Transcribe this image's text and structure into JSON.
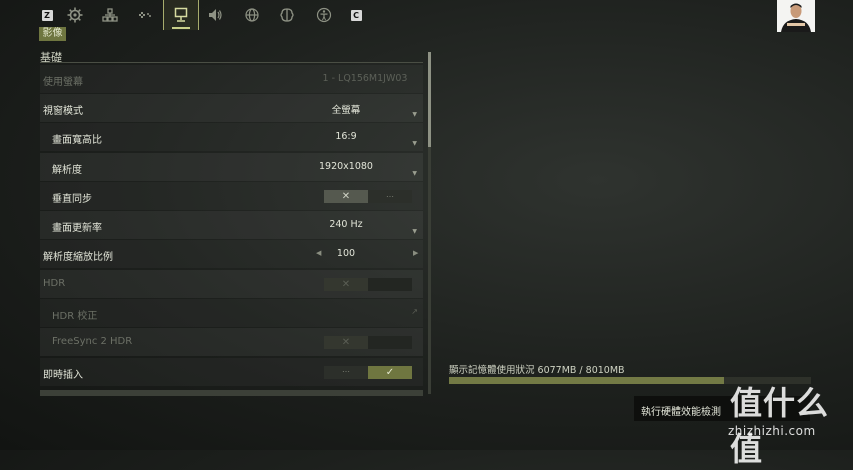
{
  "tabs": {
    "key_left": "Z",
    "key_right": "C",
    "items": [
      "gear-icon",
      "network-icon",
      "gamepad-icon",
      "display-icon",
      "audio-icon",
      "globe-icon",
      "brain-icon",
      "accessibility-icon"
    ],
    "active": "display-icon"
  },
  "category_label": "影像",
  "section_title": "基礎",
  "settings": [
    {
      "label": "使用螢幕",
      "value": "1 - LQ156M1JW03",
      "state": "dim"
    },
    {
      "label": "視窗模式",
      "value": "全螢幕"
    },
    {
      "label": "畫面寬高比",
      "value": "16:9"
    },
    {
      "label": "解析度",
      "value": "1920x1080"
    },
    {
      "label": "垂直同步",
      "toggle": "off"
    },
    {
      "label": "畫面更新率",
      "value": "240 Hz"
    },
    {
      "label": "解析度縮放比例",
      "value": "100"
    },
    {
      "label": "HDR",
      "toggle": "off",
      "state": "dim"
    },
    {
      "label": "HDR 校正",
      "state": "dim"
    },
    {
      "label": "FreeSync 2 HDR",
      "toggle": "off",
      "state": "dim"
    },
    {
      "label": "即時插入",
      "toggle": "on"
    }
  ],
  "vram": {
    "label": "顯示記憶體使用狀況 6077MB / 8010MB",
    "used_mb": 6077,
    "total_mb": 8010
  },
  "benchmark_button": "執行硬體效能檢測",
  "watermark": {
    "title": "值什么值",
    "domain": "zhizhizhi.com"
  },
  "colors": {
    "accent": "#6f7640",
    "highlight": "#c8d089"
  }
}
